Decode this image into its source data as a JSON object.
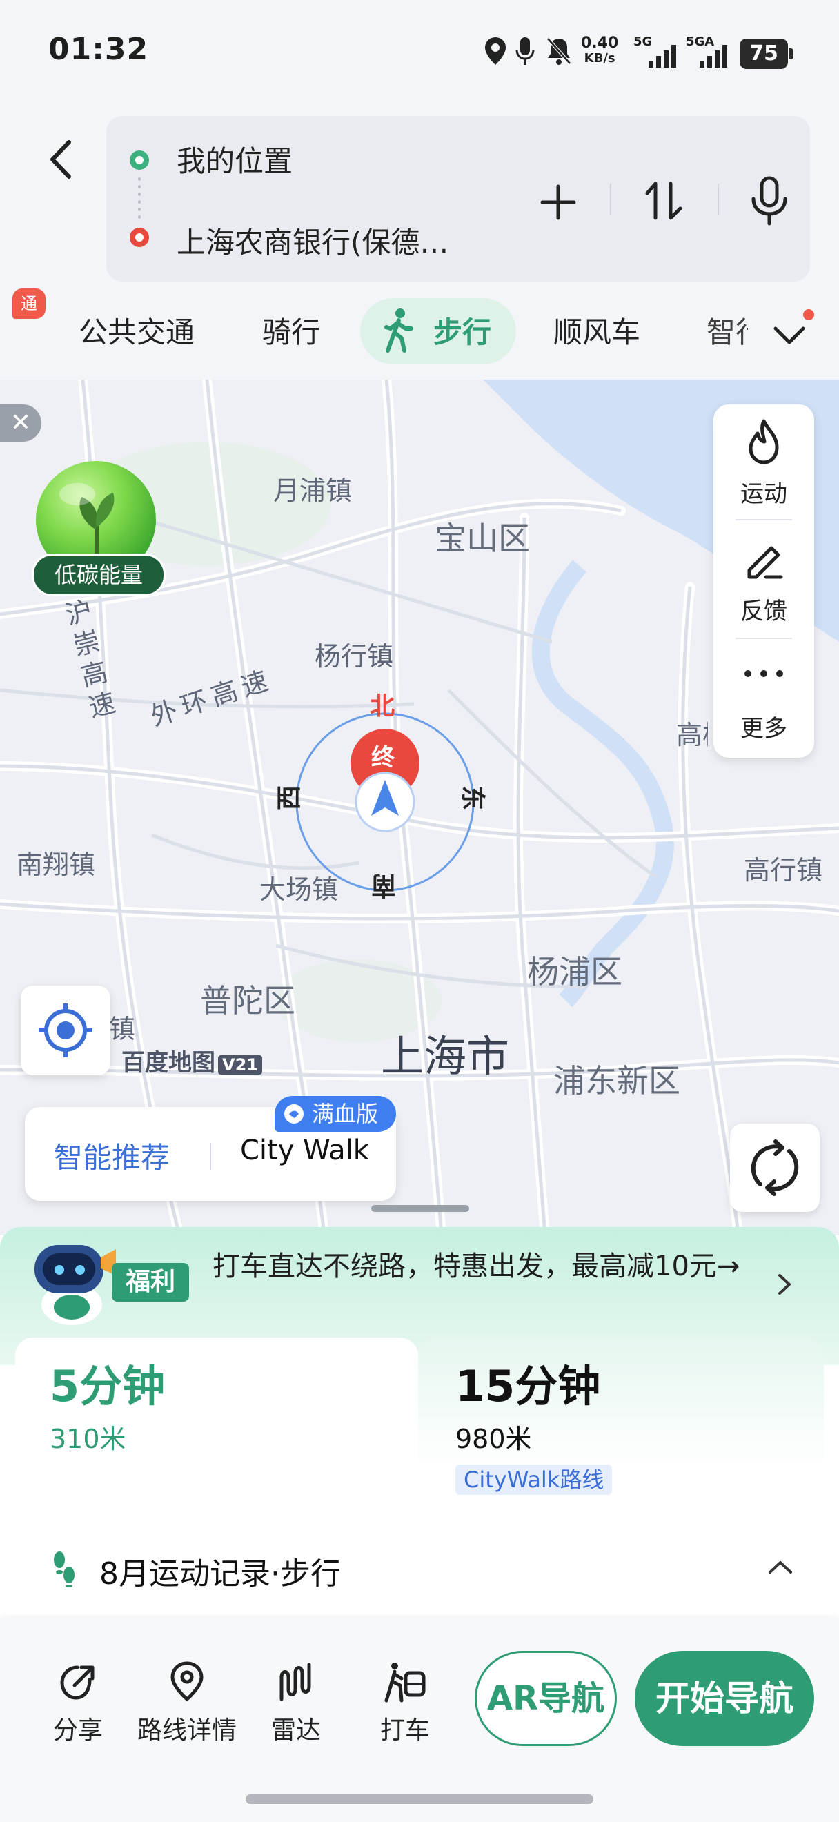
{
  "status": {
    "time": "01:32",
    "speed_value": "0.40",
    "speed_unit": "KB/s",
    "sim1": "5G",
    "sim2": "5GA",
    "battery": "75"
  },
  "route": {
    "from": "我的位置",
    "to": "上海农商银行(保德…"
  },
  "tabs": [
    {
      "label": "公共交通"
    },
    {
      "label": "骑行"
    },
    {
      "label": "步行"
    },
    {
      "label": "顺风车"
    },
    {
      "label": "智行"
    }
  ],
  "partner_badge": "通",
  "map": {
    "labels": {
      "yuepu": "月浦镇",
      "baoshan": "宝山区",
      "yanghang": "杨行镇",
      "huchong": "沪崇高速",
      "waihuan": "外环高速",
      "nanxiang": "南翔镇",
      "dachang": "大场镇",
      "gaoqiao": "高桥",
      "gaohang": "高行镇",
      "yangpu": "杨浦区",
      "putuo": "普陀区",
      "shanghai": "上海市",
      "pudong": "浦东新区",
      "zhen": "镇",
      "logo": "百度地图",
      "logo_ver": "V21"
    },
    "compass": {
      "north": "北",
      "south": "南",
      "east": "东",
      "west": "西",
      "end": "终"
    },
    "close": "✕",
    "low_carbon": "低碳能量",
    "side_panel": [
      {
        "label": "运动",
        "icon": "flame-icon"
      },
      {
        "label": "反馈",
        "icon": "edit-icon"
      },
      {
        "label": "更多",
        "icon": "more-icon"
      }
    ],
    "recommend": {
      "smart": "智能推荐",
      "citywalk": "City Walk",
      "badge": "满血版"
    }
  },
  "banner": {
    "tag": "福利",
    "text": "打车直达不绕路，特惠出发，最高减10元→"
  },
  "routes": [
    {
      "time": "5分钟",
      "distance": "310米"
    },
    {
      "time": "15分钟",
      "distance": "980米",
      "tag": "CityWalk路线"
    }
  ],
  "record": {
    "text": "8月运动记录·步行"
  },
  "bottom": {
    "share": "分享",
    "details": "路线详情",
    "radar": "雷达",
    "taxi": "打车",
    "ar": "AR导航",
    "start": "开始导航"
  },
  "colors": {
    "accent_green": "#2f9d73",
    "accent_blue": "#3b6fd6",
    "destination_red": "#e8483d",
    "compass_blue": "#4a86e8"
  }
}
